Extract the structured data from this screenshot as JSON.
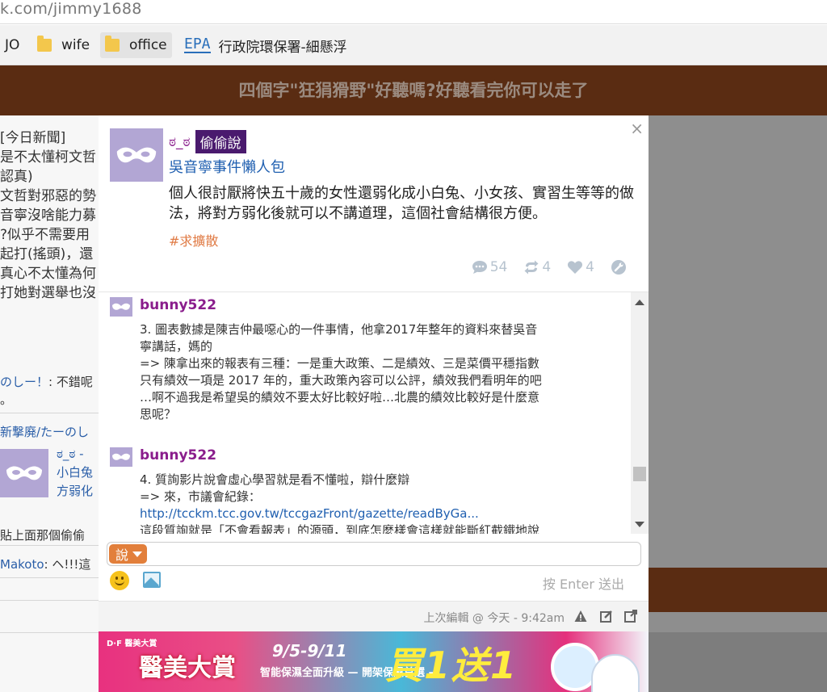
{
  "browser": {
    "url": "k.com/jimmy1688",
    "bookmarks": [
      {
        "label": "JO"
      },
      {
        "label": "wife"
      },
      {
        "label": "office"
      },
      {
        "label": "行政院環保署-細懸浮",
        "logo": "EPA"
      }
    ]
  },
  "page": {
    "header_title": "四個字\"狂狷猾野\"好聽嗎?好聽看完你可以走了",
    "left_lines": [
      "[今日新聞]",
      "是不太懂柯文哲",
      "認真)",
      "文哲對邪惡的勢",
      "音寧沒啥能力募",
      "?似乎不需要用",
      "起打(搖頭)，還",
      "真心不太懂為何",
      "打她對選舉也沒"
    ],
    "left_comment1_user": "のしー！",
    "left_comment1_text": ": 不錯呢",
    "left_comment1_extra": "。",
    "left_link": "新撃廃/たーのし",
    "left_post_user": "ಠ_ಠ -",
    "left_post_line1": "小白兔",
    "left_post_line2": "方弱化",
    "left_paste": "貼上面那個偷偷",
    "left_comment2_user": "Makoto",
    "left_comment2_text": ": ヘ!!!這"
  },
  "popup": {
    "close": "×",
    "post": {
      "username": "ಠ_ಠ",
      "tag": "偷偷說",
      "link": "吳音寧事件懶人包",
      "body": "個人很討厭將快五十歲的女性還弱化成小白兔、小女孩、實習生等等的做法，將對方弱化後就可以不講道理，這個社會結構很方便。",
      "hashtag": "#求擴散",
      "comments_count": "54",
      "reposts_count": "4",
      "likes_count": "4"
    },
    "comments": [
      {
        "user": "bunny522",
        "lines": [
          "3. 圖表數據是陳吉仲最噁心的一件事情，他拿2017年整年的資料來替吳音",
          "寧講話，媽的",
          "=> 陳拿出來的報表有三種：一是重大政策、二是績效、三是菜價平穩指數",
          "只有績效一項是 2017 年的，重大政策內容可以公評，績效我們看明年的吧",
          "…啊不過我是希望吳的績效不要太好比較好啦…北農的績效比較好是什麼意",
          "思呢？"
        ]
      },
      {
        "user": "bunny522",
        "lines": [
          "4. 質詢影片說會虛心學習就是看不懂啦，辯什麼辯",
          "=> 來，市議會紀錄："
        ],
        "url": "http://tcckm.tcc.gov.tw/tccgazFront/gazette/readByGa...",
        "tail": "這段質詢就是「不會看報表」的源頭，到底怎麼樣會這樣就能斷紅截鐵地說"
      }
    ],
    "reply": {
      "say_label": "說",
      "send_hint": "按 Enter 送出"
    },
    "footer": {
      "edited": "上次編輯 @ 今天 - 9:42am"
    },
    "ad": {
      "logo": "D·F 醫美大賞",
      "title": "醫美大賞",
      "dates": "9/5-9/11",
      "subtitle": "智能保濕全面升級 — 開架保濕首選 —",
      "promo": "買1送1"
    }
  }
}
